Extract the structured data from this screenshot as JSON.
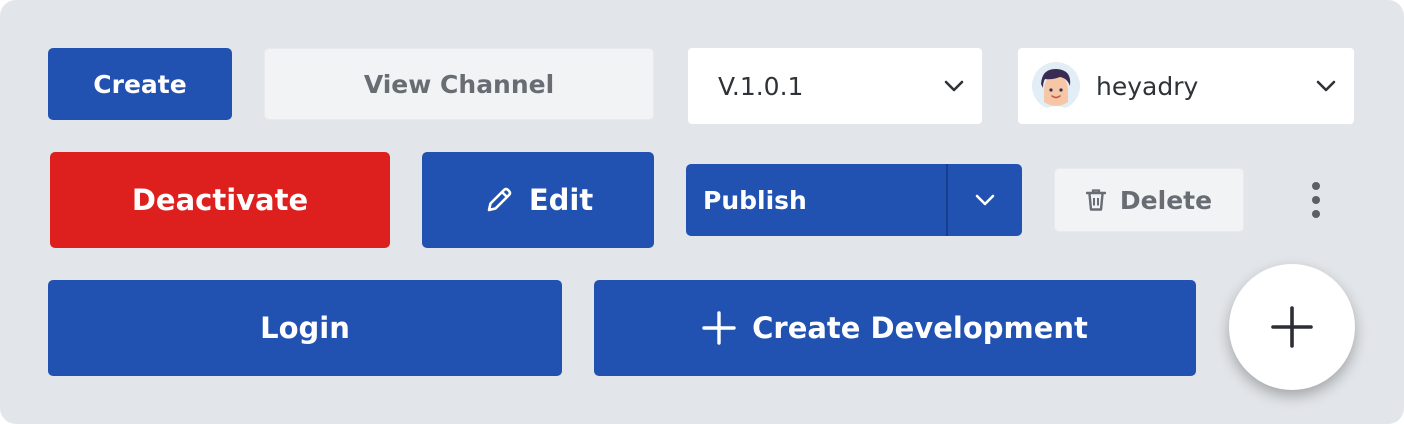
{
  "row1": {
    "create_label": "Create",
    "view_channel_label": "View Channel",
    "version_select": {
      "value": "V.1.0.1",
      "icon": "chevron-down-icon"
    },
    "user_select": {
      "value": "heyadry",
      "avatar": "avatar",
      "icon": "chevron-down-icon"
    }
  },
  "row2": {
    "deactivate_label": "Deactivate",
    "edit_label": "Edit",
    "edit_icon": "pencil-icon",
    "publish_label": "Publish",
    "publish_icon": "chevron-down-icon",
    "delete_label": "Delete",
    "delete_icon": "trash-icon",
    "more_icon": "more-vertical-icon"
  },
  "row3": {
    "login_label": "Login",
    "create_development_label": "Create Development",
    "create_development_icon": "plus-icon",
    "fab_icon": "plus-icon"
  },
  "colors": {
    "primary": "#2152b2",
    "danger": "#dd1f1d",
    "background": "#e2e5e9",
    "ghost": "#f2f3f5"
  }
}
